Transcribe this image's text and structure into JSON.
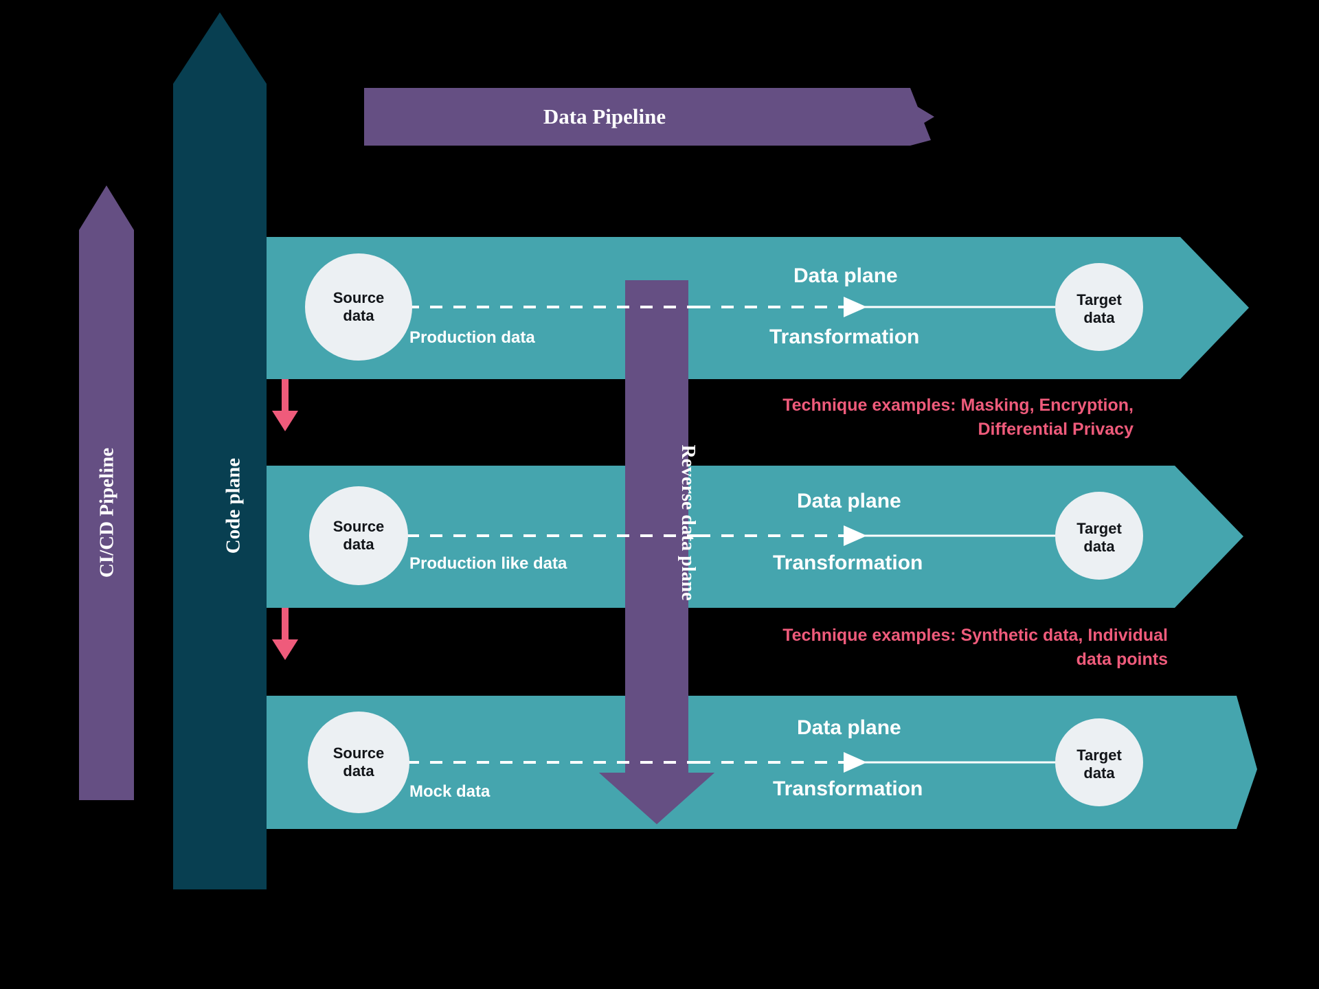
{
  "diagram": {
    "title": "Data pipeline planes diagram",
    "background_color": "#000000",
    "colors": {
      "purple": "#654f83",
      "dark_teal": "#083f51",
      "teal": "#45a5ae",
      "circle_fill": "#ecf0f3",
      "pink": "#ef5b7b",
      "white": "#ffffff"
    }
  },
  "cicd_pipeline": {
    "label": "CI/CD Pipeline",
    "direction": "up",
    "color": "#654f83"
  },
  "code_plane": {
    "label": "Code plane",
    "direction": "up",
    "color": "#083f51"
  },
  "data_pipeline": {
    "label": "Data Pipeline",
    "direction": "right",
    "color": "#654f83"
  },
  "reverse_data_plane": {
    "label": "Reverse data plane",
    "direction": "down",
    "color": "#654f83"
  },
  "rows": [
    {
      "id": "row-production",
      "source_label": "Source\ndata",
      "target_label": "Target\ndata",
      "connector_label": "Production data",
      "data_plane_label": "Data plane",
      "transformation_label": "Transformation",
      "color": "#45a5ae"
    },
    {
      "id": "row-production-like",
      "source_label": "Source\ndata",
      "target_label": "Target\ndata",
      "connector_label": "Production like data",
      "data_plane_label": "Data plane",
      "transformation_label": "Transformation",
      "color": "#45a5ae"
    },
    {
      "id": "row-mock",
      "source_label": "Source\ndata",
      "target_label": "Target\ndata",
      "connector_label": "Mock data",
      "data_plane_label": "Data plane",
      "transformation_label": "Transformation",
      "color": "#45a5ae"
    }
  ],
  "annotations": [
    {
      "id": "techniques-1",
      "text": "Technique examples: Masking, Encryption,\nDifferential Privacy",
      "color": "#ef5b7b"
    },
    {
      "id": "techniques-2",
      "text": "Technique examples: Synthetic data, Individual\ndata points",
      "color": "#ef5b7b"
    }
  ],
  "flow_arrows": [
    {
      "id": "flow-arrow-1",
      "direction": "down",
      "color": "#ef5b7b"
    },
    {
      "id": "flow-arrow-2",
      "direction": "down",
      "color": "#ef5b7b"
    }
  ]
}
